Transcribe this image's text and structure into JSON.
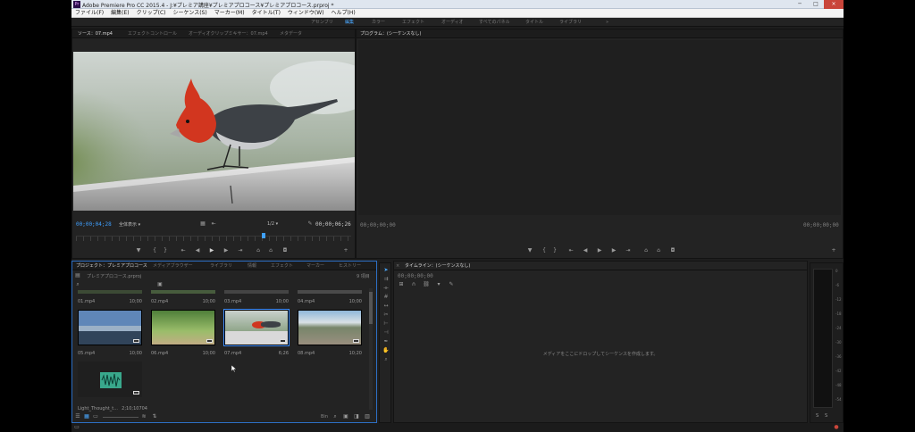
{
  "window": {
    "title": "Adobe Premiere Pro CC 2015.4 - J:¥プレミア講座¥プレミアプロコース¥プレミアプロコース.prproj *",
    "controls": [
      "─",
      "□",
      "×"
    ]
  },
  "menu": [
    "ファイル(F)",
    "編集(E)",
    "クリップ(C)",
    "シーケンス(S)",
    "マーカー(M)",
    "タイトル(T)",
    "ウィンドウ(W)",
    "ヘルプ(H)"
  ],
  "workspaces": {
    "items": [
      "アセンブリ",
      "編集",
      "カラー",
      "エフェクト",
      "オーディオ",
      "すべてのパネル",
      "タイトル",
      "ライブラリ",
      "»"
    ],
    "active_index": 1
  },
  "source_panel": {
    "tabs": [
      "ソース：07.mp4",
      "エフェクトコントロール",
      "オーディオクリップミキサー：07.mp4",
      "メタデータ"
    ],
    "timecode_current": "00;00;04;28",
    "fit": "全体表示",
    "resolution": "1/2",
    "timecode_duration": "00;00;06;26"
  },
  "program_panel": {
    "tab": "プログラム：(シーケンスなし)",
    "timecode_left": "00;00;00;00",
    "timecode_right": "00;00;00;00"
  },
  "project_panel": {
    "tabs": [
      "プロジェクト：プレミアプロコース",
      "メディアブラウザー",
      "ライブラリ",
      "情報",
      "エフェクト",
      "マーカー",
      "ヒストリー"
    ],
    "project_file": "プレミアプロコース.prproj",
    "item_count": "9 項目",
    "row1": [
      {
        "name": "01.mp4",
        "dur": "10;00"
      },
      {
        "name": "02.mp4",
        "dur": "10;00"
      },
      {
        "name": "03.mp4",
        "dur": "10;00"
      },
      {
        "name": "04.mp4",
        "dur": "10;00"
      }
    ],
    "row2": [
      {
        "name": "05.mp4",
        "dur": "10;00"
      },
      {
        "name": "06.mp4",
        "dur": "10;00"
      },
      {
        "name": "07.mp4",
        "dur": "6;26"
      },
      {
        "name": "08.mp4",
        "dur": "10;20"
      }
    ],
    "audio_item": {
      "name": "Light_Thought_t...",
      "dur": "2;10;10704"
    },
    "bin_label": "Bin"
  },
  "timeline_panel": {
    "tab": "タイムライン：(シーケンスなし)",
    "timecode": "00;00;00;00",
    "drop_hint": "メディアをここにドロップしてシーケンスを作成します。"
  },
  "meter": {
    "scale": [
      "0",
      "-6",
      "-12",
      "-18",
      "-24",
      "-30",
      "-36",
      "-42",
      "-48",
      "-54"
    ],
    "solo": [
      "S",
      "S"
    ]
  }
}
